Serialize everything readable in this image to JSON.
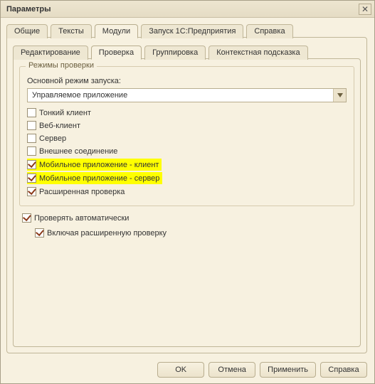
{
  "window": {
    "title": "Параметры"
  },
  "tabs": {
    "general": "Общие",
    "texts": "Тексты",
    "modules": "Модули",
    "launch": "Запуск 1С:Предприятия",
    "help": "Справка"
  },
  "inner_tabs": {
    "editing": "Редактирование",
    "check": "Проверка",
    "grouping": "Группировка",
    "context_hint": "Контекстная подсказка"
  },
  "check_modes": {
    "legend": "Режимы проверки",
    "main_mode_label": "Основной режим запуска:",
    "main_mode_value": "Управляемое приложение",
    "items": {
      "thin_client": "Тонкий клиент",
      "web_client": "Веб-клиент",
      "server": "Сервер",
      "external_conn": "Внешнее соединение",
      "mobile_client": "Мобильное приложение - клиент",
      "mobile_server": "Мобильное приложение - сервер",
      "extended_check": "Расширенная проверка"
    }
  },
  "auto": {
    "check_auto": "Проверять автоматически",
    "including_extended": "Включая расширенную проверку"
  },
  "buttons": {
    "ok": "OK",
    "cancel": "Отмена",
    "apply": "Применить",
    "help": "Справка"
  }
}
